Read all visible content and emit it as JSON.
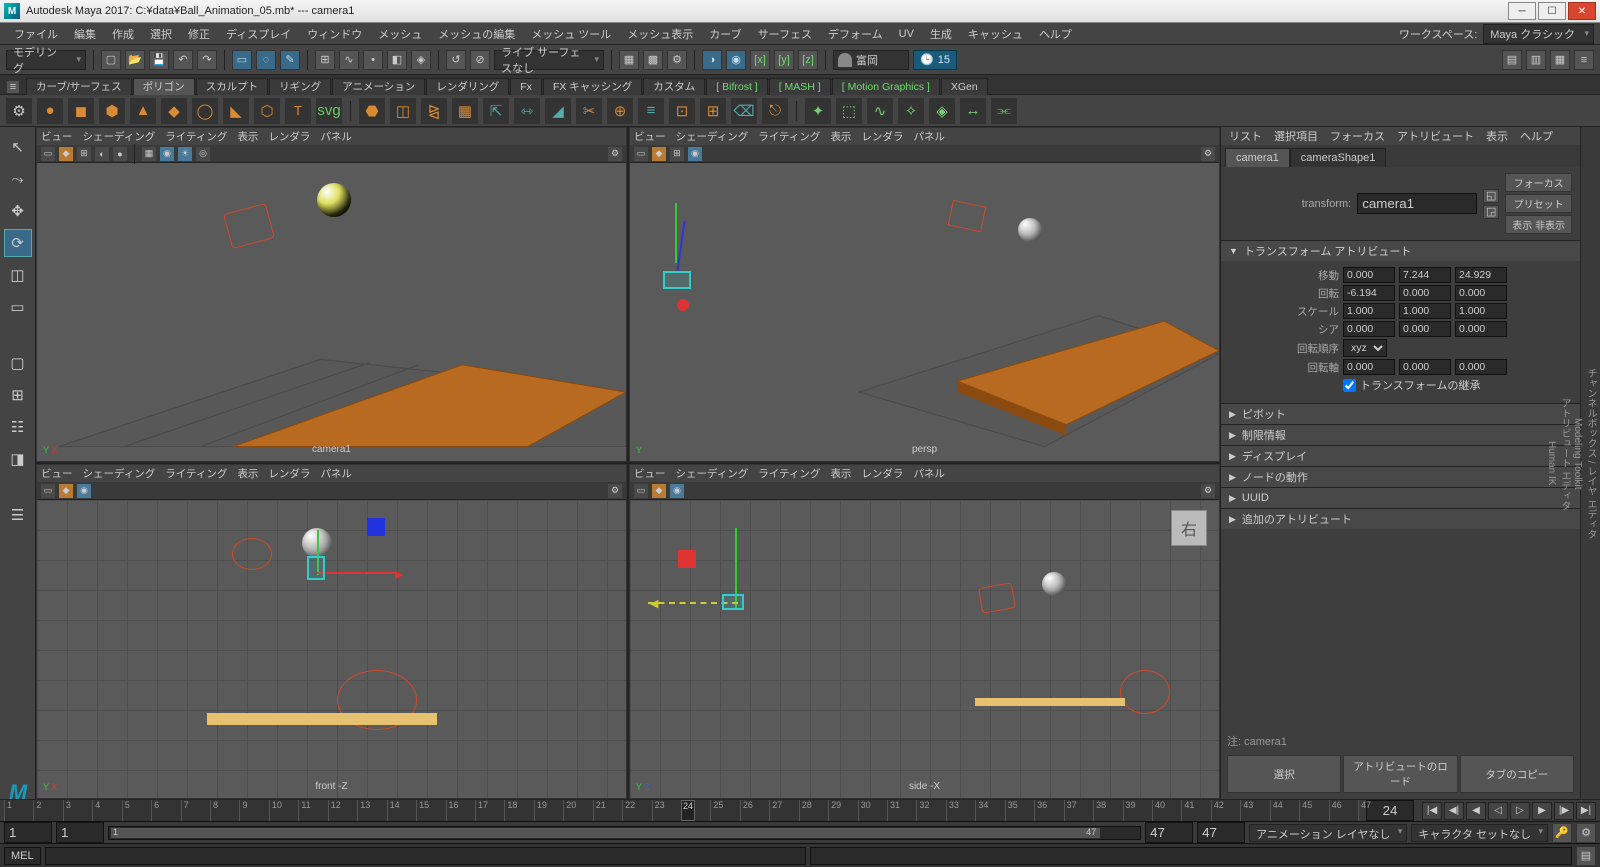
{
  "title": "Autodesk Maya 2017: C:¥data¥Ball_Animation_05.mb*  ---  camera1",
  "menubar": [
    "ファイル",
    "編集",
    "作成",
    "選択",
    "修正",
    "ディスプレイ",
    "ウィンドウ",
    "メッシュ",
    "メッシュの編集",
    "メッシュ ツール",
    "メッシュ表示",
    "カーブ",
    "サーフェス",
    "デフォーム",
    "UV",
    "生成",
    "キャッシュ",
    "ヘルプ"
  ],
  "workspace_label": "ワークスペース:",
  "workspace_value": "Maya クラシック",
  "module_dropdown": "モデリング",
  "status_user": "富岡",
  "status_frame": "15",
  "filtermode": "ライブ サーフェスなし",
  "shelf_tabs": [
    {
      "label": "カーブ/サーフェス",
      "active": false
    },
    {
      "label": "ポリゴン",
      "active": true
    },
    {
      "label": "スカルプト",
      "active": false
    },
    {
      "label": "リギング",
      "active": false
    },
    {
      "label": "アニメーション",
      "active": false
    },
    {
      "label": "レンダリング",
      "active": false
    },
    {
      "label": "Fx",
      "active": false
    },
    {
      "label": "FX キャッシング",
      "active": false
    },
    {
      "label": "カスタム",
      "active": false
    },
    {
      "label": "Bifrost",
      "active": false,
      "green": true
    },
    {
      "label": "MASH",
      "active": false,
      "green": true
    },
    {
      "label": "Motion Graphics",
      "active": false,
      "green": true
    },
    {
      "label": "XGen",
      "active": false
    }
  ],
  "panel_menu": [
    "ビュー",
    "シェーディング",
    "ライティング",
    "表示",
    "レンダラ",
    "パネル"
  ],
  "view_labels": {
    "tl": "camera1",
    "tr": "persp",
    "bl": "front -Z",
    "br": "side -X"
  },
  "attr": {
    "menu": [
      "リスト",
      "選択項目",
      "フォーカス",
      "アトリビュート",
      "表示",
      "ヘルプ"
    ],
    "tabs": [
      "camera1",
      "cameraShape1"
    ],
    "transform_lbl": "transform:",
    "transform_val": "camera1",
    "btn_focus": "フォーカス",
    "btn_preset": "プリセット",
    "btn_showhide": "表示 非表示",
    "sec_transform": "トランスフォーム アトリビュート",
    "rows": {
      "translate": {
        "lbl": "移動",
        "x": "0.000",
        "y": "7.244",
        "z": "24.929"
      },
      "rotate": {
        "lbl": "回転",
        "x": "-6.194",
        "y": "0.000",
        "z": "0.000"
      },
      "scale": {
        "lbl": "スケール",
        "x": "1.000",
        "y": "1.000",
        "z": "1.000"
      },
      "shear": {
        "lbl": "シア",
        "x": "0.000",
        "y": "0.000",
        "z": "0.000"
      },
      "rotorder": {
        "lbl": "回転順序",
        "val": "xyz"
      },
      "rotaxis": {
        "lbl": "回転軸",
        "x": "0.000",
        "y": "0.000",
        "z": "0.000"
      },
      "inherit": "トランスフォームの継承"
    },
    "sections": [
      "ピボット",
      "制限情報",
      "ディスプレイ",
      "ノードの動作",
      "UUID",
      "追加のアトリビュート"
    ],
    "note_lbl": "注:",
    "note_val": "camera1",
    "foot": [
      "選択",
      "アトリビュートのロード",
      "タブのコピー"
    ]
  },
  "sidetabs": [
    "チャンネルボックス / レイヤ エディタ",
    "Modeling Toolkit",
    "アトリビュート エディタ",
    "Human IK"
  ],
  "timeline": {
    "start": "1",
    "end": "47",
    "cur": "24",
    "cur_display": "24",
    "range_start": "1",
    "range_end": "47",
    "outer_start": "1",
    "outer_end": "47",
    "anim_layer": "アニメーション レイヤなし",
    "char_set": "キャラクタ セットなし"
  },
  "cmd": {
    "lang": "MEL"
  },
  "viewcube": "右"
}
